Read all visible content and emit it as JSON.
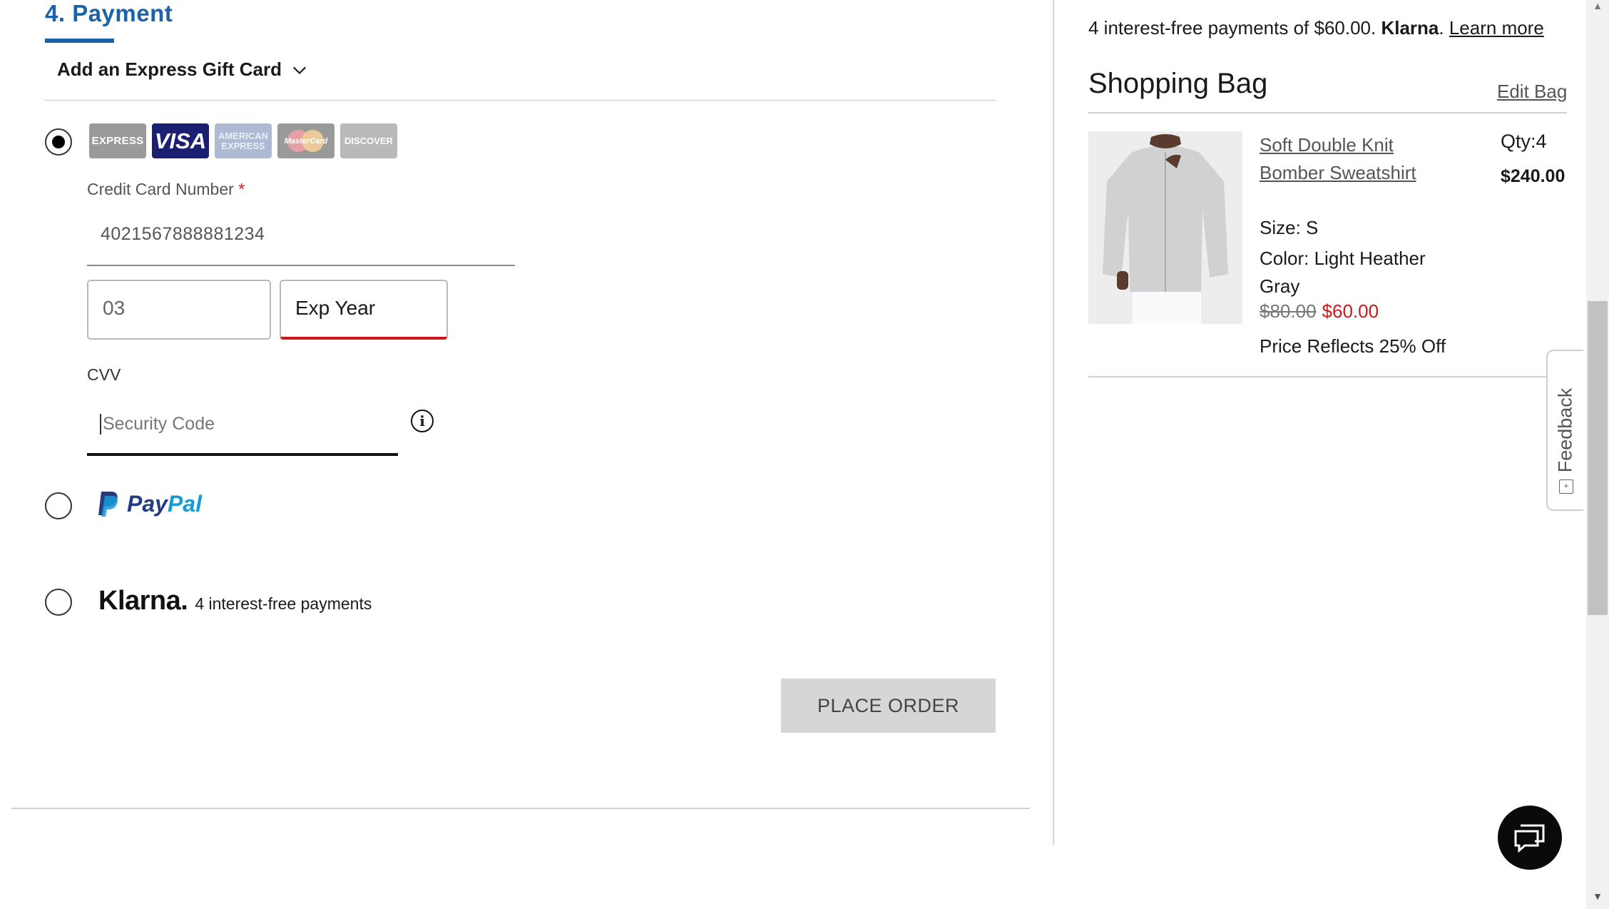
{
  "payment": {
    "step_title": "4. Payment",
    "gift_card_label": "Add an Express Gift Card",
    "methods": {
      "credit_card": {
        "selected": true,
        "card_brands": [
          "EXPRESS",
          "VISA",
          "AMERICAN EXPRESS",
          "MasterCard",
          "DISCOVER"
        ],
        "card_number_label": "Credit Card Number",
        "required_marker": "*",
        "card_number_value": "4021567888881234",
        "exp_month_value": "03",
        "exp_year_placeholder": "Exp Year",
        "cvv_label": "CVV",
        "cvv_placeholder": "Security Code"
      },
      "paypal": {
        "selected": false,
        "label_pay": "Pay",
        "label_pal": "Pal"
      },
      "klarna": {
        "selected": false,
        "logo": "Klarna.",
        "text": "4 interest-free payments"
      }
    },
    "place_order_label": "PLACE ORDER"
  },
  "summary": {
    "klarna_note_prefix": "4 interest-free payments of $60.00.",
    "klarna_note_brand": "Klarna",
    "klarna_note_link": "Learn more",
    "bag_title": "Shopping Bag",
    "edit_bag_label": "Edit Bag",
    "item": {
      "name": "Soft Double Knit Bomber Sweatshirt",
      "size": "Size: S",
      "color": "Color: Light Heather Gray",
      "old_price": "$80.00",
      "new_price": "$60.00",
      "discount_note": "Price Reflects 25% Off",
      "qty": "Qty:4",
      "line_total": "$240.00"
    }
  },
  "widgets": {
    "feedback_label": "Feedback"
  },
  "colors": {
    "accent_blue": "#1b63a8",
    "error_red": "#d0161b",
    "sale_red": "#d0161b",
    "button_disabled": "#d6d6d6"
  }
}
